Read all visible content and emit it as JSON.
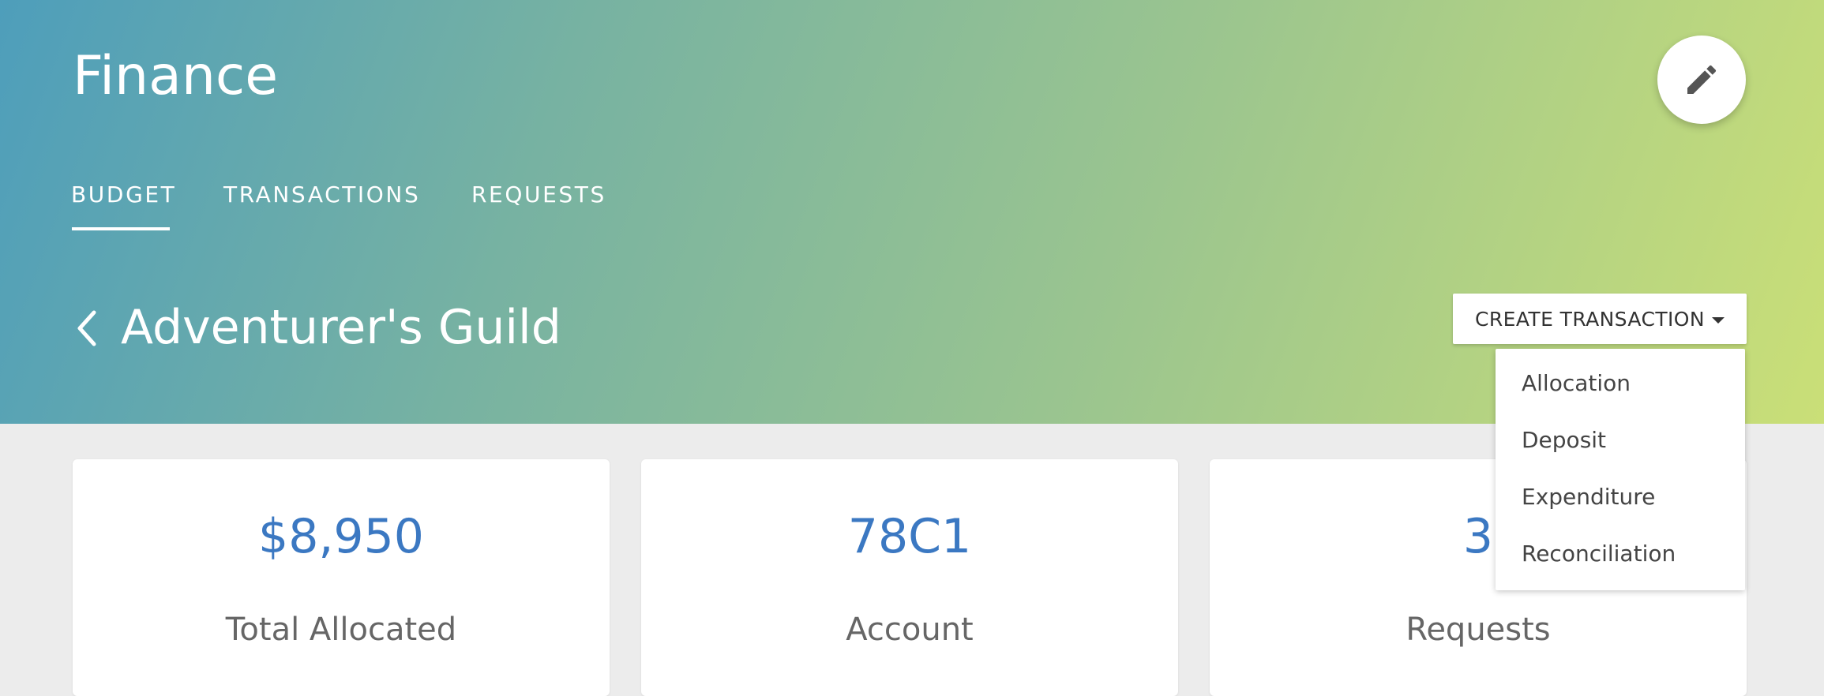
{
  "app": {
    "title": "Finance"
  },
  "tabs": [
    {
      "label": "BUDGET",
      "active": true
    },
    {
      "label": "TRANSACTIONS",
      "active": false
    },
    {
      "label": "REQUESTS",
      "active": false
    }
  ],
  "page": {
    "title": "Adventurer's Guild"
  },
  "toolbar": {
    "create_transaction_label": "CREATE TRANSACTION",
    "edit_icon": "pencil-icon",
    "back_icon": "chevron-left-icon"
  },
  "dropdown": {
    "open": true,
    "items": [
      "Allocation",
      "Deposit",
      "Expenditure",
      "Reconciliation"
    ]
  },
  "cards": [
    {
      "value": "$8,950",
      "label": "Total Allocated"
    },
    {
      "value": "78C1",
      "label": "Account"
    },
    {
      "value": "3",
      "label": "Requests"
    }
  ],
  "colors": {
    "gradient_start": "#4e9ebb",
    "gradient_end": "#cadf77",
    "accent_value": "#3b78c2",
    "page_background": "#ececec"
  }
}
